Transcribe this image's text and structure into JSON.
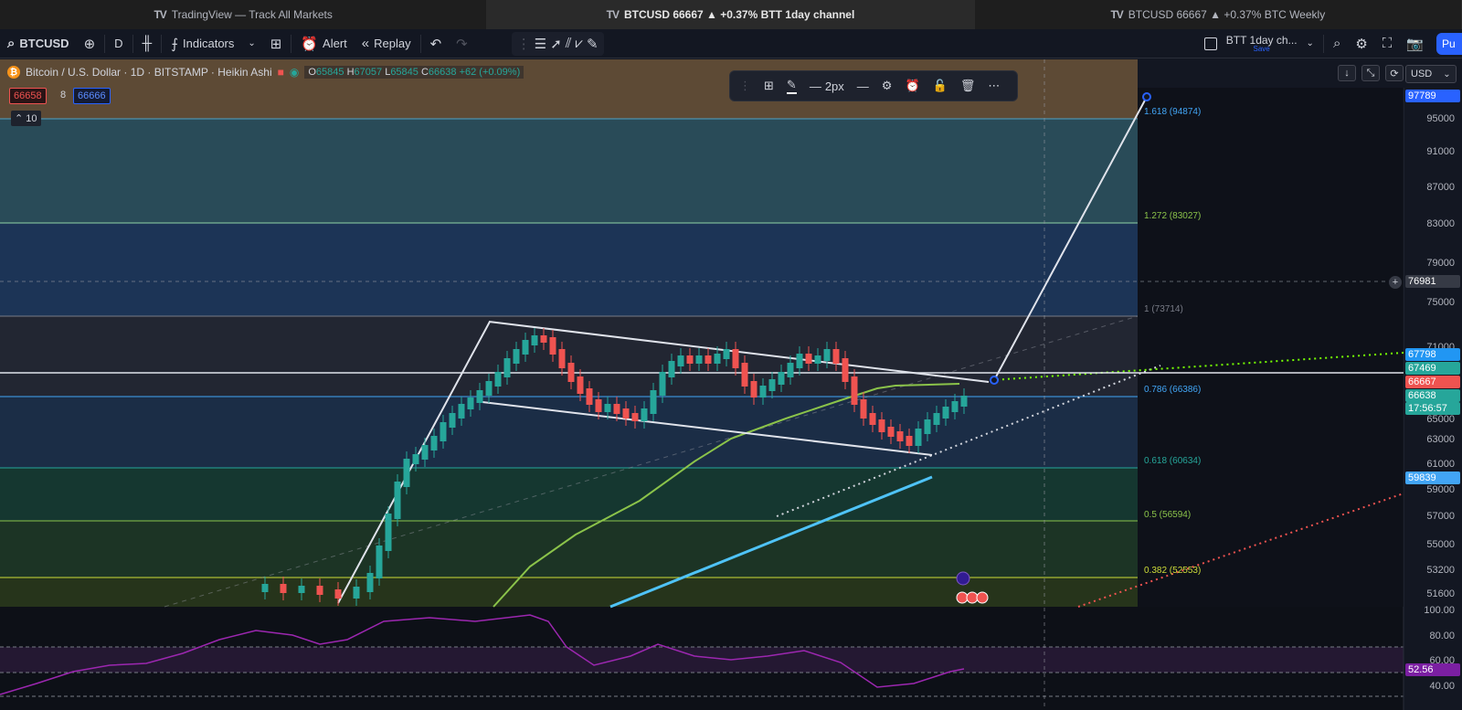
{
  "tabs": [
    {
      "label": "TradingView — Track All Markets",
      "active": false
    },
    {
      "label": "BTCUSD 66667 ▲ +0.37% BTT 1day channel",
      "active": true
    },
    {
      "label": "BTCUSD 66667 ▲ +0.37% BTC Weekly",
      "active": false
    }
  ],
  "tab_logo": "TV",
  "toolbar": {
    "symbol": "BTCUSD",
    "interval": "D",
    "indicators_label": "Indicators",
    "alert_label": "Alert",
    "replay_label": "Replay",
    "layout_name": "BTT 1day ch...",
    "layout_save": "Save",
    "publish_label": "Pu"
  },
  "legend": {
    "title": "Bitcoin / U.S. Dollar · 1D · BITSTAMP · Heikin Ashi",
    "open_label": "O",
    "open": "65845",
    "high_label": "H",
    "high": "67057",
    "low_label": "L",
    "low": "65845",
    "close_label": "C",
    "close": "66638",
    "change": "+62 (+0.09%)",
    "bid": "66658",
    "spread": "8",
    "ask": "66666",
    "volume_tag": "10"
  },
  "drawing_toolbar": {
    "width_label": "2px"
  },
  "currency": "USD",
  "price_axis": [
    "95000",
    "91000",
    "87000",
    "83000",
    "79000",
    "75000",
    "71000",
    "69000",
    "65000",
    "63000",
    "61000",
    "59000",
    "57000",
    "55000",
    "53200",
    "51600"
  ],
  "price_tags": [
    {
      "value": "97789",
      "color": "#2962ff"
    },
    {
      "value": "76981",
      "color": "#363a45"
    },
    {
      "value": "67798",
      "color": "#2196f3"
    },
    {
      "value": "67469",
      "color": "#26a69a"
    },
    {
      "value": "66667",
      "color": "#ef5350"
    },
    {
      "value": "66638",
      "color": "#26a69a"
    },
    {
      "value": "17:56:57",
      "color": "#26a69a"
    },
    {
      "value": "59839",
      "color": "#42a5f5"
    }
  ],
  "fib_levels": [
    {
      "label": "1.618 (94874)",
      "color": "#42a5f5"
    },
    {
      "label": "1.272 (83027)",
      "color": "#8bc34a"
    },
    {
      "label": "1 (73714)",
      "color": "#787b86"
    },
    {
      "label": "0.786 (66386)",
      "color": "#42a5f5"
    },
    {
      "label": "0.618 (60634)",
      "color": "#26a69a"
    },
    {
      "label": "0.5 (56594)",
      "color": "#8bc34a"
    },
    {
      "label": "0.382 (52553)",
      "color": "#cddc39"
    }
  ],
  "rsi_axis": [
    "100.00",
    "80.00",
    "60.00",
    "40.00"
  ],
  "rsi_value": "52.56",
  "colors": {
    "bull": "#26a69a",
    "bear": "#ef5350",
    "rsi": "#9c27b0"
  }
}
